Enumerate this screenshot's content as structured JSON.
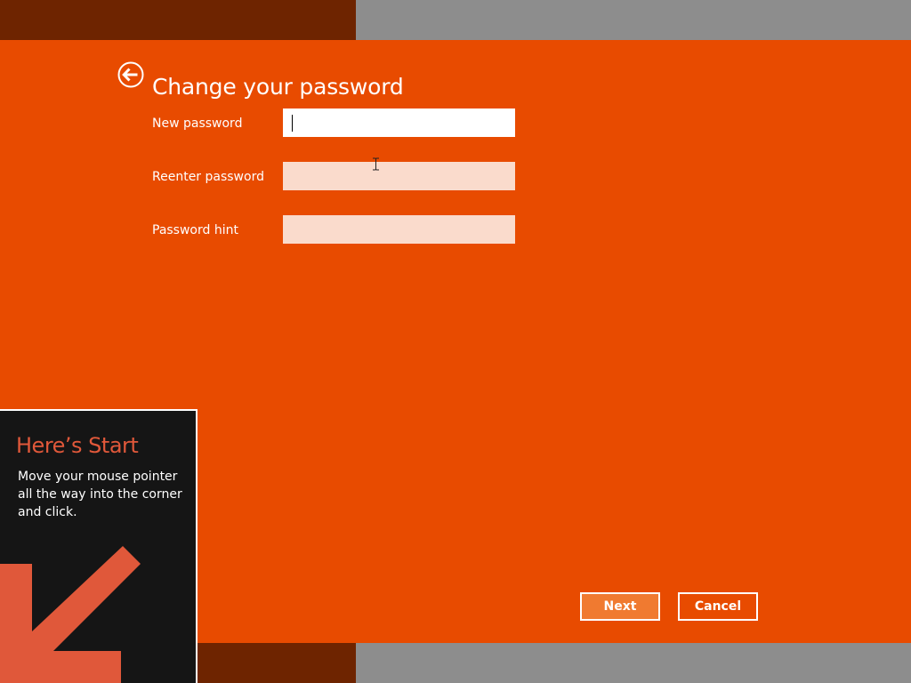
{
  "dialog": {
    "title": "Change your password",
    "back_icon": "back-arrow-circle-icon",
    "background_color": "#e84b00"
  },
  "fields": [
    {
      "label": "New password",
      "value": "",
      "placeholder": "",
      "state": "focused"
    },
    {
      "label": "Reenter password",
      "value": "",
      "placeholder": "",
      "state": "idle"
    },
    {
      "label": "Password hint",
      "value": "",
      "placeholder": "",
      "state": "idle"
    }
  ],
  "buttons": {
    "next_label": "Next",
    "cancel_label": "Cancel"
  },
  "start_tip": {
    "title": "Here’s Start",
    "body": "Move your mouse pointer all the way into the corner and click.",
    "arrow_icon": "arrow-down-left-icon",
    "title_color": "#e0583a",
    "arrow_color": "#e0583a"
  }
}
